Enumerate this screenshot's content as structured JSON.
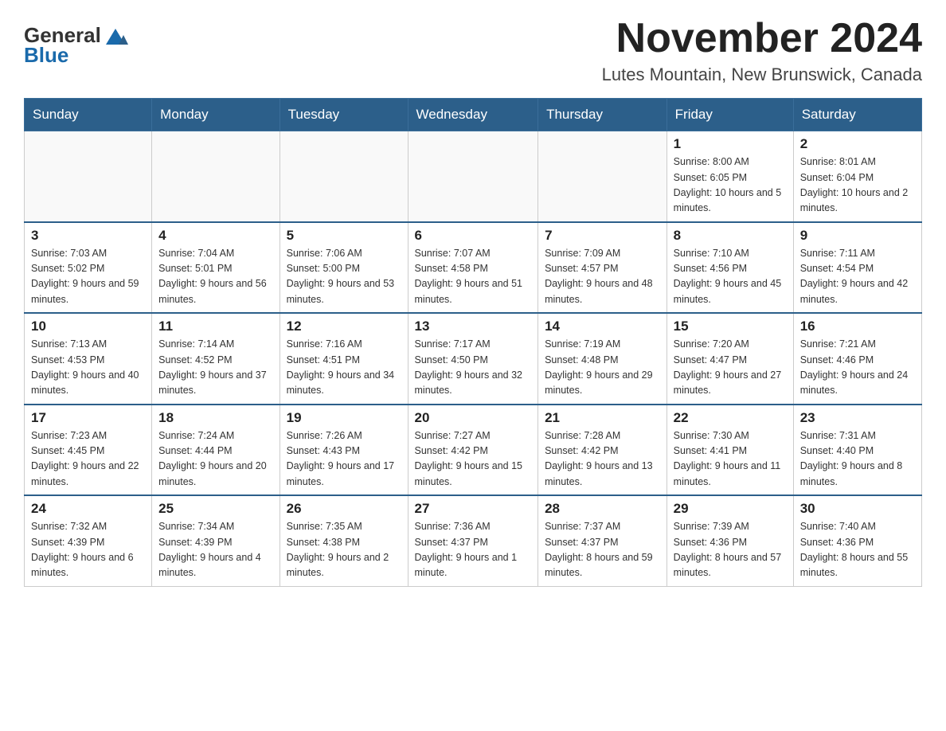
{
  "header": {
    "logo_general": "General",
    "logo_blue": "Blue",
    "month_title": "November 2024",
    "location": "Lutes Mountain, New Brunswick, Canada"
  },
  "days_of_week": [
    "Sunday",
    "Monday",
    "Tuesday",
    "Wednesday",
    "Thursday",
    "Friday",
    "Saturday"
  ],
  "weeks": [
    [
      {
        "day": "",
        "info": ""
      },
      {
        "day": "",
        "info": ""
      },
      {
        "day": "",
        "info": ""
      },
      {
        "day": "",
        "info": ""
      },
      {
        "day": "",
        "info": ""
      },
      {
        "day": "1",
        "info": "Sunrise: 8:00 AM\nSunset: 6:05 PM\nDaylight: 10 hours and 5 minutes."
      },
      {
        "day": "2",
        "info": "Sunrise: 8:01 AM\nSunset: 6:04 PM\nDaylight: 10 hours and 2 minutes."
      }
    ],
    [
      {
        "day": "3",
        "info": "Sunrise: 7:03 AM\nSunset: 5:02 PM\nDaylight: 9 hours and 59 minutes."
      },
      {
        "day": "4",
        "info": "Sunrise: 7:04 AM\nSunset: 5:01 PM\nDaylight: 9 hours and 56 minutes."
      },
      {
        "day": "5",
        "info": "Sunrise: 7:06 AM\nSunset: 5:00 PM\nDaylight: 9 hours and 53 minutes."
      },
      {
        "day": "6",
        "info": "Sunrise: 7:07 AM\nSunset: 4:58 PM\nDaylight: 9 hours and 51 minutes."
      },
      {
        "day": "7",
        "info": "Sunrise: 7:09 AM\nSunset: 4:57 PM\nDaylight: 9 hours and 48 minutes."
      },
      {
        "day": "8",
        "info": "Sunrise: 7:10 AM\nSunset: 4:56 PM\nDaylight: 9 hours and 45 minutes."
      },
      {
        "day": "9",
        "info": "Sunrise: 7:11 AM\nSunset: 4:54 PM\nDaylight: 9 hours and 42 minutes."
      }
    ],
    [
      {
        "day": "10",
        "info": "Sunrise: 7:13 AM\nSunset: 4:53 PM\nDaylight: 9 hours and 40 minutes."
      },
      {
        "day": "11",
        "info": "Sunrise: 7:14 AM\nSunset: 4:52 PM\nDaylight: 9 hours and 37 minutes."
      },
      {
        "day": "12",
        "info": "Sunrise: 7:16 AM\nSunset: 4:51 PM\nDaylight: 9 hours and 34 minutes."
      },
      {
        "day": "13",
        "info": "Sunrise: 7:17 AM\nSunset: 4:50 PM\nDaylight: 9 hours and 32 minutes."
      },
      {
        "day": "14",
        "info": "Sunrise: 7:19 AM\nSunset: 4:48 PM\nDaylight: 9 hours and 29 minutes."
      },
      {
        "day": "15",
        "info": "Sunrise: 7:20 AM\nSunset: 4:47 PM\nDaylight: 9 hours and 27 minutes."
      },
      {
        "day": "16",
        "info": "Sunrise: 7:21 AM\nSunset: 4:46 PM\nDaylight: 9 hours and 24 minutes."
      }
    ],
    [
      {
        "day": "17",
        "info": "Sunrise: 7:23 AM\nSunset: 4:45 PM\nDaylight: 9 hours and 22 minutes."
      },
      {
        "day": "18",
        "info": "Sunrise: 7:24 AM\nSunset: 4:44 PM\nDaylight: 9 hours and 20 minutes."
      },
      {
        "day": "19",
        "info": "Sunrise: 7:26 AM\nSunset: 4:43 PM\nDaylight: 9 hours and 17 minutes."
      },
      {
        "day": "20",
        "info": "Sunrise: 7:27 AM\nSunset: 4:42 PM\nDaylight: 9 hours and 15 minutes."
      },
      {
        "day": "21",
        "info": "Sunrise: 7:28 AM\nSunset: 4:42 PM\nDaylight: 9 hours and 13 minutes."
      },
      {
        "day": "22",
        "info": "Sunrise: 7:30 AM\nSunset: 4:41 PM\nDaylight: 9 hours and 11 minutes."
      },
      {
        "day": "23",
        "info": "Sunrise: 7:31 AM\nSunset: 4:40 PM\nDaylight: 9 hours and 8 minutes."
      }
    ],
    [
      {
        "day": "24",
        "info": "Sunrise: 7:32 AM\nSunset: 4:39 PM\nDaylight: 9 hours and 6 minutes."
      },
      {
        "day": "25",
        "info": "Sunrise: 7:34 AM\nSunset: 4:39 PM\nDaylight: 9 hours and 4 minutes."
      },
      {
        "day": "26",
        "info": "Sunrise: 7:35 AM\nSunset: 4:38 PM\nDaylight: 9 hours and 2 minutes."
      },
      {
        "day": "27",
        "info": "Sunrise: 7:36 AM\nSunset: 4:37 PM\nDaylight: 9 hours and 1 minute."
      },
      {
        "day": "28",
        "info": "Sunrise: 7:37 AM\nSunset: 4:37 PM\nDaylight: 8 hours and 59 minutes."
      },
      {
        "day": "29",
        "info": "Sunrise: 7:39 AM\nSunset: 4:36 PM\nDaylight: 8 hours and 57 minutes."
      },
      {
        "day": "30",
        "info": "Sunrise: 7:40 AM\nSunset: 4:36 PM\nDaylight: 8 hours and 55 minutes."
      }
    ]
  ]
}
